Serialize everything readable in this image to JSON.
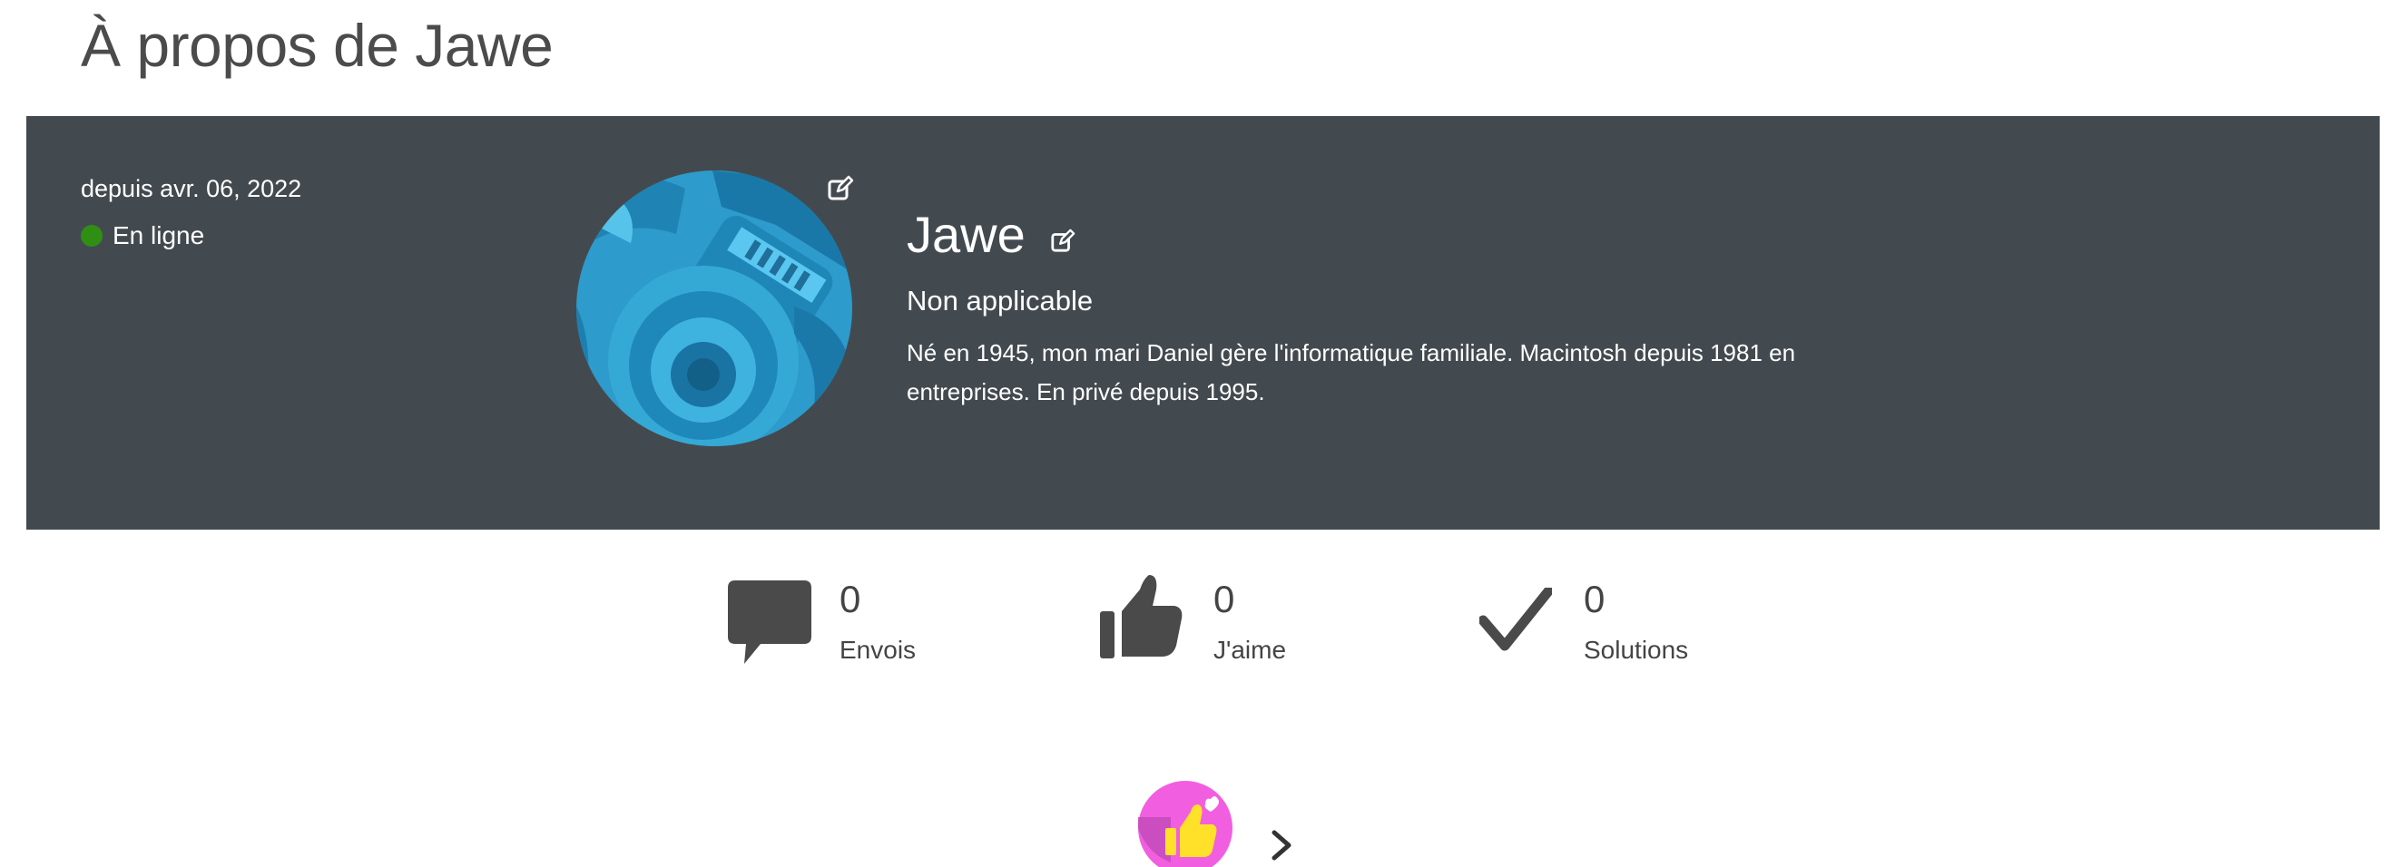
{
  "page": {
    "title": "À propos de Jawe"
  },
  "profile": {
    "member_since": "depuis avr. 06, 2022",
    "status": "En ligne",
    "name": "Jawe",
    "role": "Non applicable",
    "bio": "Né en 1945, mon mari Daniel gère l'informatique familiale. Macintosh depuis 1981 en entreprises. En privé depuis 1995.",
    "avatar_icon": "camera-lens-icon",
    "edit_icon": "edit-icon",
    "status_color": "#2f8e14"
  },
  "stats": [
    {
      "value": "0",
      "label": "Envois",
      "icon": "speech-bubble-icon"
    },
    {
      "value": "0",
      "label": "J'aime",
      "icon": "thumbs-up-icon"
    },
    {
      "value": "0",
      "label": "Solutions",
      "icon": "checkmark-icon"
    }
  ],
  "badges": {
    "icon": "thumbs-up-heart-badge-icon",
    "next_icon": "chevron-right-icon"
  },
  "colors": {
    "banner": "#434a4f",
    "text_dark": "#444444",
    "badge_pink": "#f25ee0"
  }
}
